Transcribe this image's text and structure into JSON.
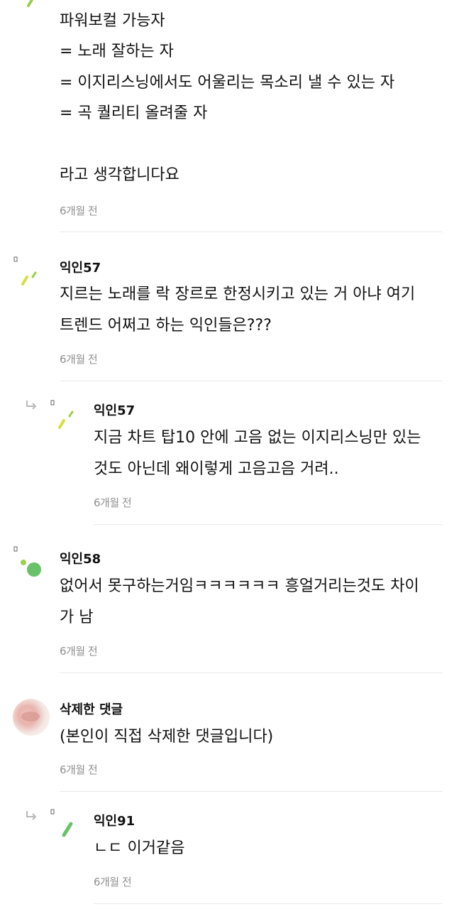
{
  "colors": {
    "accent_green": "#9bcf4e",
    "accent_yellow": "#d8de3c",
    "dot_green": "#69c26a",
    "muted_text": "#8f8f8f",
    "divider": "#e9e9e9"
  },
  "top_comment": {
    "lines": [
      "파워보컬 가능자",
      "= 노래 잘하는 자",
      "= 이지리스닝에서도 어울리는 목소리 낼 수 있는 자",
      "= 곡 퀄리티 올려줄 자",
      "",
      "라고 생각합니다요"
    ],
    "time": "6개월 전"
  },
  "comments": [
    {
      "author": "익인57",
      "lines": [
        "지르는 노래를 락 장르로 한정시키고 있는 거 아냐 여기",
        "트렌드 어쩌고 하는 익인들은???"
      ],
      "time": "6개월 전",
      "reply": false,
      "avatar_icon": "dash-avatar-icon"
    },
    {
      "author": "익인57",
      "lines": [
        "지금 차트 탑10 안에 고음 없는 이지리스닝만 있는",
        "것도 아닌데 왜이렇게 고음고음 거려.."
      ],
      "time": "6개월 전",
      "reply": true,
      "avatar_icon": "dash-avatar-icon"
    },
    {
      "author": "익인58",
      "lines": [
        "없어서 못구하는거임ㅋㅋㅋㅋㅋㅋ 흥얼거리는것도 차이",
        "가 남"
      ],
      "time": "6개월 전",
      "reply": false,
      "avatar_icon": "dot-avatar-icon"
    },
    {
      "author": "삭제한 댓글",
      "lines": [
        "(본인이 직접 삭제한 댓글입니다)"
      ],
      "time": "6개월 전",
      "reply": false,
      "avatar_icon": "photo-avatar"
    },
    {
      "author": "익인91",
      "lines": [
        "ㄴㄷ 이거같음"
      ],
      "time": "6개월 전",
      "reply": true,
      "avatar_icon": "slash-avatar-icon"
    }
  ],
  "icons": {
    "reply": "reply-arrow-icon"
  }
}
